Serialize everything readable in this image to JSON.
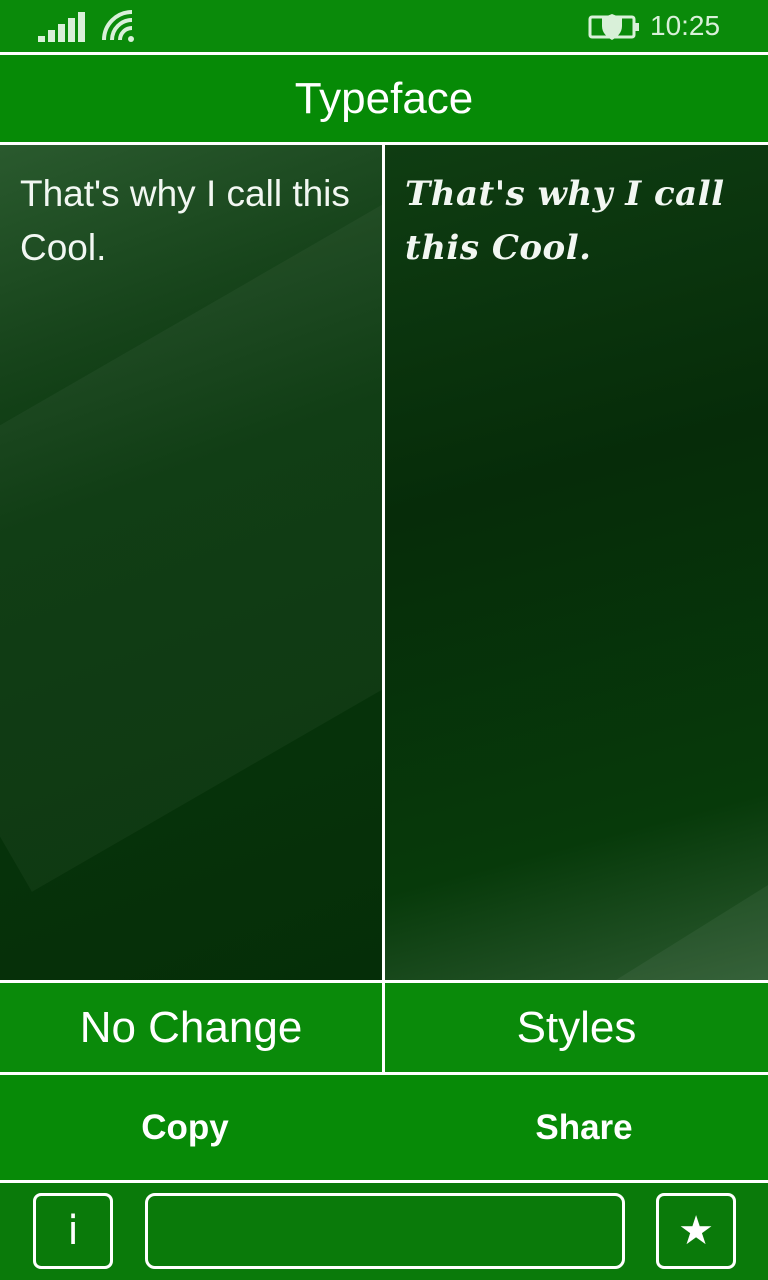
{
  "status_bar": {
    "time": "10:25",
    "icons": [
      "signal-strength-icon",
      "wifi-icon",
      "battery-saver-icon"
    ]
  },
  "header": {
    "title": "Typeface"
  },
  "panes": {
    "original_text": "That's why I call this Cool.",
    "styled_text": "That's why I call this Cool."
  },
  "mode_buttons": {
    "left_label": "No Change",
    "right_label": "Styles"
  },
  "actions": {
    "copy_label": "Copy",
    "share_label": "Share"
  },
  "bottom_bar": {
    "info_label": "i",
    "star_label": "★",
    "input_value": ""
  },
  "colors": {
    "accent_green": "#0a8a0a",
    "pane_dark_green": "#052e08",
    "divider": "#ffffff"
  }
}
